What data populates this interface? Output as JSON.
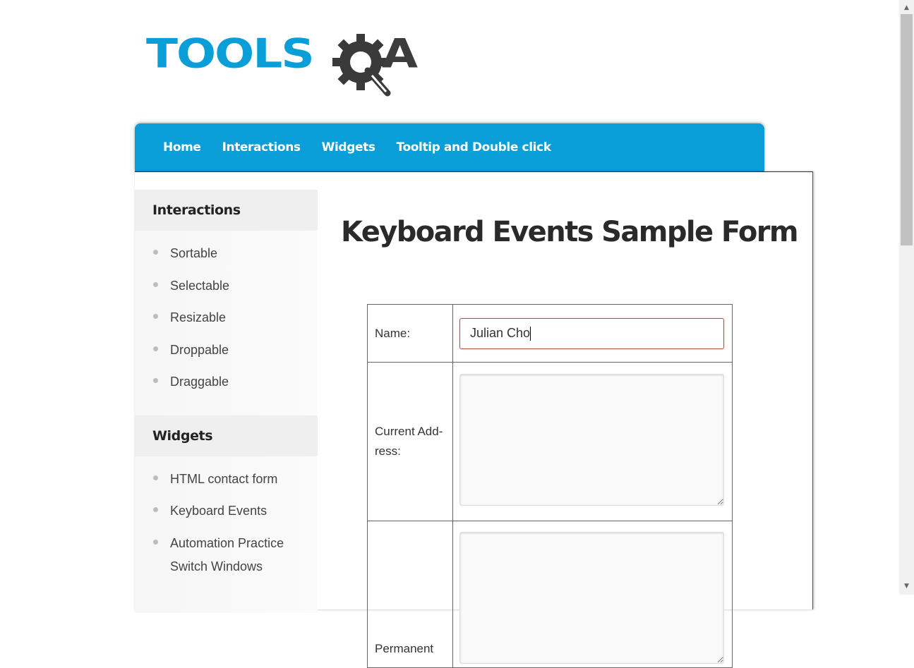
{
  "logo": {
    "text_tools": "TOOLS",
    "text_a": "A"
  },
  "nav": {
    "items": [
      "Home",
      "Interactions",
      "Widgets",
      "Tooltip and Double click"
    ]
  },
  "sidebar": {
    "sections": [
      {
        "title": "Interactions",
        "items": [
          "Sortable",
          "Selectable",
          "Resizable",
          "Droppable",
          "Draggable"
        ]
      },
      {
        "title": "Widgets",
        "items": [
          "HTML contact form",
          "Keyboard Events",
          "Automation Practice",
          "Switch Windows"
        ]
      }
    ]
  },
  "main": {
    "title": "Keyboard Events Sample Form",
    "form": {
      "name_label": "Name:",
      "name_value": "Julian Cho",
      "current_address_label": "Current Add­ress:",
      "current_address_value": "",
      "permanent_address_label": "Permanent",
      "permanent_address_value": ""
    }
  },
  "scrollbar": {
    "up_icon": "▲",
    "down_icon": "▼"
  }
}
